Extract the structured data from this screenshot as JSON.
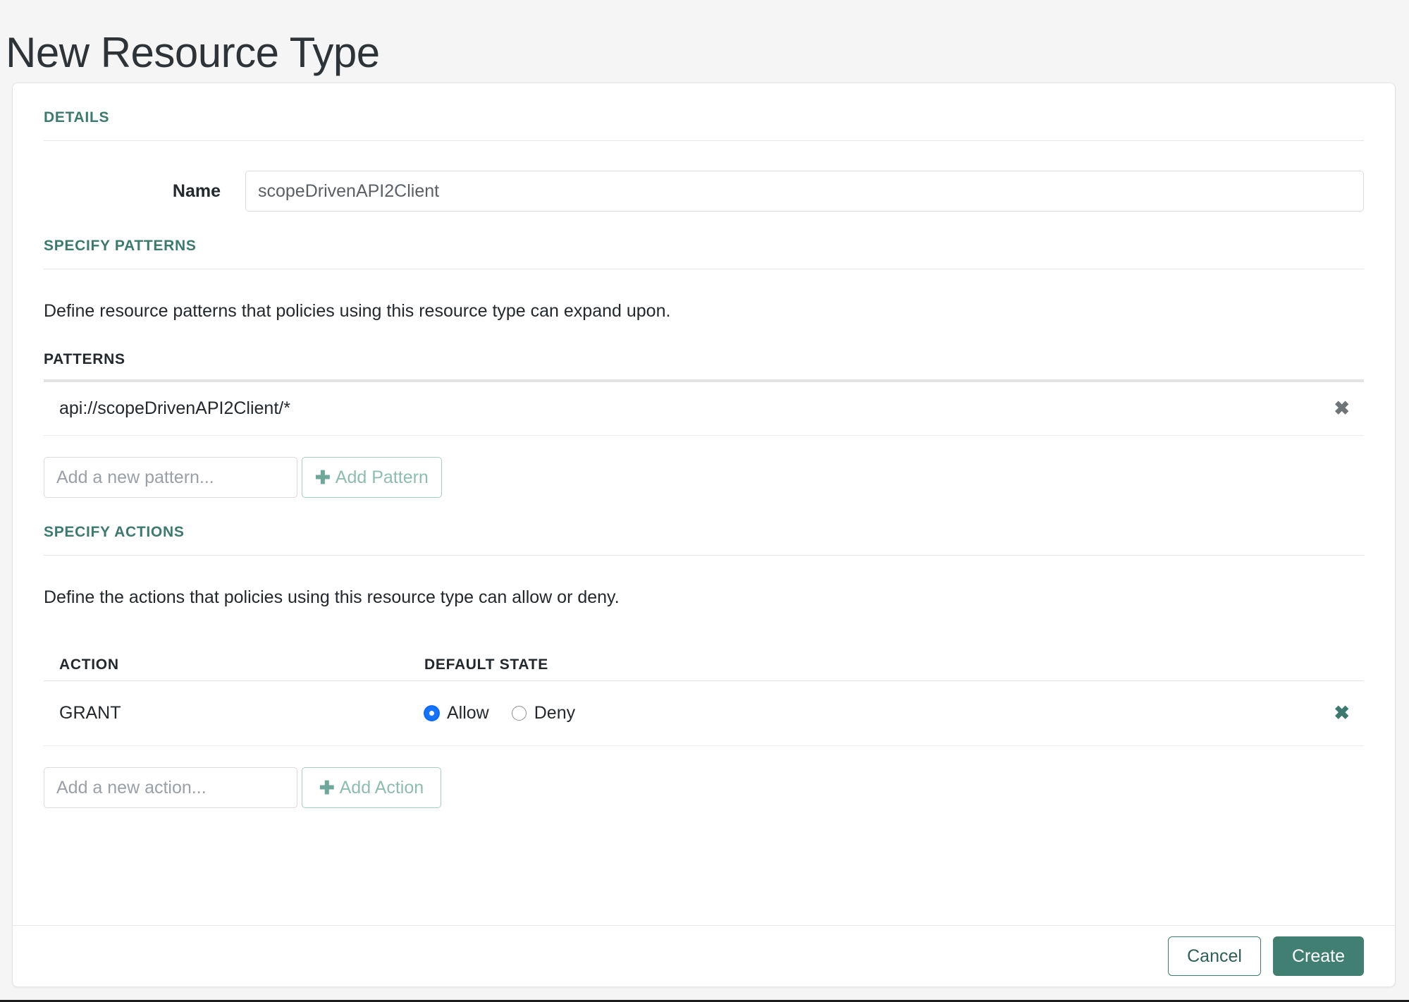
{
  "page": {
    "title": "New Resource Type"
  },
  "details": {
    "heading": "DETAILS",
    "name_label": "Name",
    "name_value": "scopeDrivenAPI2Client",
    "name_placeholder": ""
  },
  "patterns_section": {
    "heading": "SPECIFY PATTERNS",
    "description": "Define resource patterns that policies using this resource type can expand upon.",
    "table_heading": "PATTERNS",
    "rows": [
      {
        "pattern": "api://scopeDrivenAPI2Client/*",
        "remove_icon": "✖"
      }
    ],
    "add_placeholder": "Add a new pattern...",
    "add_value": "",
    "add_button_label": "Add Pattern",
    "add_button_icon": "✚"
  },
  "actions_section": {
    "heading": "SPECIFY ACTIONS",
    "description": "Define the actions that policies using this resource type can allow or deny.",
    "columns": {
      "action": "ACTION",
      "default_state": "DEFAULT STATE"
    },
    "rows": [
      {
        "action": "GRANT",
        "allow_label": "Allow",
        "deny_label": "Deny",
        "selected": "Allow",
        "remove_icon": "✖"
      }
    ],
    "add_placeholder": "Add a new action...",
    "add_value": "",
    "add_button_label": "Add Action",
    "add_button_icon": "✚"
  },
  "footer": {
    "cancel_label": "Cancel",
    "create_label": "Create"
  },
  "colors": {
    "accent_teal": "#3d7a6e",
    "primary_button": "#417f73",
    "radio_selected_blue": "#1673ff",
    "page_background": "#f5f5f5",
    "card_background": "#ffffff"
  }
}
